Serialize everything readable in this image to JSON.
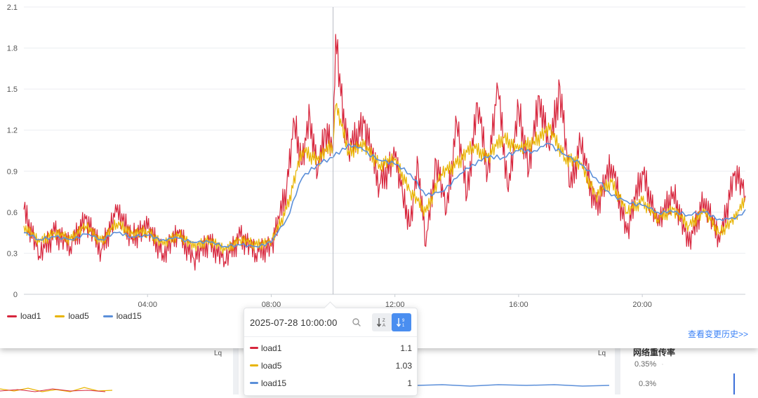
{
  "chart_data": {
    "type": "line",
    "x_range": [
      "2025-07-28 00:00",
      "2025-07-28 23:20"
    ],
    "x_ticks": [
      "04:00",
      "08:00",
      "12:00",
      "16:00",
      "20:00"
    ],
    "y_ticks": [
      "0",
      "0.3",
      "0.6",
      "0.9",
      "1.2",
      "1.5",
      "1.8",
      "2.1"
    ],
    "ylim": [
      0,
      2.1
    ],
    "grid": true,
    "legend_position": "bottom-left",
    "crosshair_time": "10:00",
    "series": [
      {
        "name": "load1",
        "color": "#d7263d",
        "times": [
          "00:00",
          "00:30",
          "01:00",
          "01:30",
          "02:00",
          "02:30",
          "03:00",
          "03:30",
          "04:00",
          "04:30",
          "05:00",
          "05:30",
          "06:00",
          "06:30",
          "07:00",
          "07:30",
          "08:00",
          "08:15",
          "08:30",
          "08:45",
          "09:00",
          "09:15",
          "09:30",
          "09:45",
          "10:00",
          "10:05",
          "10:15",
          "10:30",
          "11:00",
          "11:30",
          "12:00",
          "12:15",
          "12:30",
          "12:45",
          "13:00",
          "13:20",
          "13:40",
          "14:00",
          "14:20",
          "14:40",
          "15:00",
          "15:20",
          "15:40",
          "16:00",
          "16:20",
          "16:40",
          "17:00",
          "17:20",
          "17:40",
          "18:00",
          "18:30",
          "19:00",
          "19:30",
          "20:00",
          "20:30",
          "21:00",
          "21:30",
          "22:00",
          "22:30",
          "23:00",
          "23:20"
        ],
        "values": [
          0.62,
          0.28,
          0.45,
          0.35,
          0.55,
          0.32,
          0.6,
          0.42,
          0.48,
          0.3,
          0.44,
          0.26,
          0.38,
          0.24,
          0.42,
          0.3,
          0.35,
          0.55,
          0.78,
          1.25,
          0.95,
          1.3,
          0.88,
          1.2,
          1.05,
          1.9,
          1.45,
          1.05,
          1.25,
          0.8,
          1.0,
          0.72,
          0.5,
          0.95,
          0.35,
          0.98,
          0.6,
          1.25,
          0.72,
          1.4,
          0.9,
          1.5,
          0.75,
          1.35,
          0.9,
          1.45,
          1.05,
          1.52,
          0.78,
          1.1,
          0.62,
          0.95,
          0.45,
          0.9,
          0.5,
          0.75,
          0.35,
          0.7,
          0.38,
          0.9,
          0.72
        ]
      },
      {
        "name": "load5",
        "color": "#e8b400",
        "times": [
          "00:00",
          "00:30",
          "01:00",
          "01:30",
          "02:00",
          "02:30",
          "03:00",
          "03:30",
          "04:00",
          "04:30",
          "05:00",
          "05:30",
          "06:00",
          "06:30",
          "07:00",
          "07:30",
          "08:00",
          "08:30",
          "09:00",
          "09:30",
          "10:00",
          "10:05",
          "10:30",
          "11:00",
          "11:30",
          "12:00",
          "12:30",
          "13:00",
          "13:30",
          "14:00",
          "14:30",
          "15:00",
          "15:30",
          "16:00",
          "16:30",
          "17:00",
          "17:30",
          "18:00",
          "18:30",
          "19:00",
          "19:30",
          "20:00",
          "20:30",
          "21:00",
          "21:30",
          "22:00",
          "22:30",
          "23:00",
          "23:20"
        ],
        "values": [
          0.5,
          0.38,
          0.45,
          0.4,
          0.5,
          0.38,
          0.52,
          0.44,
          0.46,
          0.36,
          0.44,
          0.34,
          0.4,
          0.32,
          0.4,
          0.36,
          0.38,
          0.62,
          1.05,
          0.98,
          1.1,
          1.38,
          1.05,
          1.08,
          0.95,
          0.98,
          0.75,
          0.6,
          0.88,
          0.95,
          1.08,
          1.0,
          1.15,
          1.05,
          1.12,
          1.2,
          1.0,
          0.95,
          0.72,
          0.82,
          0.6,
          0.68,
          0.55,
          0.62,
          0.5,
          0.6,
          0.45,
          0.55,
          0.7
        ]
      },
      {
        "name": "load15",
        "color": "#5b8fd9",
        "times": [
          "00:00",
          "00:30",
          "01:00",
          "01:30",
          "02:00",
          "02:30",
          "03:00",
          "03:30",
          "04:00",
          "04:30",
          "05:00",
          "05:30",
          "06:00",
          "06:30",
          "07:00",
          "07:30",
          "08:00",
          "08:30",
          "09:00",
          "09:30",
          "10:00",
          "10:30",
          "11:00",
          "11:30",
          "12:00",
          "12:30",
          "13:00",
          "13:30",
          "14:00",
          "14:30",
          "15:00",
          "15:30",
          "16:00",
          "16:30",
          "17:00",
          "17:30",
          "18:00",
          "18:30",
          "19:00",
          "19:30",
          "20:00",
          "20:30",
          "21:00",
          "21:30",
          "22:00",
          "22:30",
          "23:00",
          "23:20"
        ],
        "values": [
          0.45,
          0.4,
          0.42,
          0.4,
          0.44,
          0.4,
          0.45,
          0.42,
          0.43,
          0.4,
          0.41,
          0.38,
          0.38,
          0.35,
          0.36,
          0.35,
          0.38,
          0.55,
          0.85,
          0.95,
          1.0,
          1.1,
          1.05,
          0.98,
          0.95,
          0.88,
          0.72,
          0.75,
          0.85,
          0.95,
          1.0,
          1.0,
          1.05,
          1.05,
          1.1,
          1.02,
          0.95,
          0.85,
          0.72,
          0.68,
          0.65,
          0.6,
          0.6,
          0.58,
          0.6,
          0.55,
          0.55,
          0.62
        ]
      }
    ]
  },
  "legend": {
    "items": [
      "load1",
      "load5",
      "load15"
    ]
  },
  "history_link": "查看变更历史>>",
  "tooltip": {
    "timestamp": "2025-07-28 10:00:00",
    "rows": [
      {
        "name": "load1",
        "value": "1.1",
        "color": "#d7263d"
      },
      {
        "name": "load5",
        "value": "1.03",
        "color": "#e8b400"
      },
      {
        "name": "load15",
        "value": "1",
        "color": "#5b8fd9"
      }
    ]
  },
  "background": {
    "card_right_title": "网络重传率",
    "card_right_ticks": [
      "0.35%",
      "0.3%"
    ]
  }
}
